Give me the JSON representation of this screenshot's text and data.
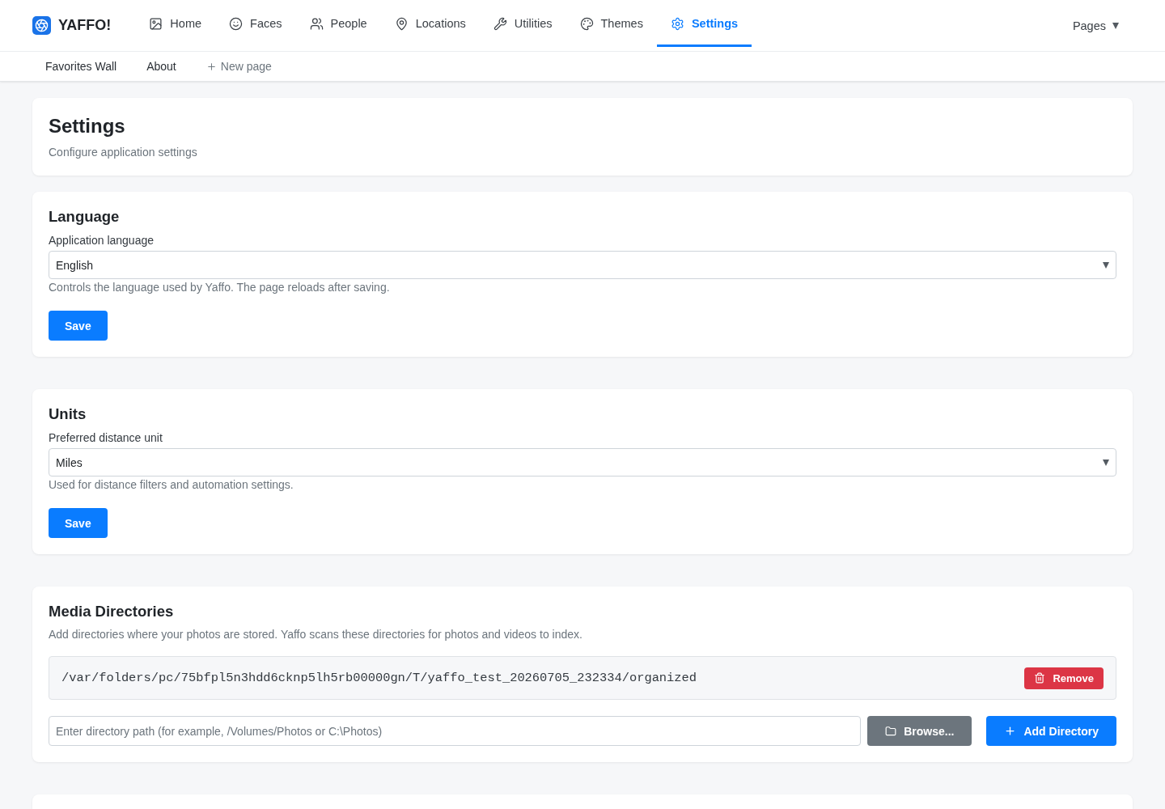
{
  "navbar": {
    "brand": "YAFFO!",
    "items": [
      {
        "label": "Home",
        "selected": false
      },
      {
        "label": "Faces",
        "selected": false
      },
      {
        "label": "People",
        "selected": false
      },
      {
        "label": "Locations",
        "selected": false
      },
      {
        "label": "Utilities",
        "selected": false
      },
      {
        "label": "Themes",
        "selected": false
      },
      {
        "label": "Settings",
        "selected": true
      }
    ],
    "pages_menu": "Pages"
  },
  "subnav": {
    "links": [
      "Favorites Wall",
      "About"
    ],
    "new_page": "New page"
  },
  "header": {
    "title": "Settings",
    "subtitle": "Configure application settings"
  },
  "sections": [
    {
      "kind": "select",
      "title": "Language",
      "field_label": "Application language",
      "value": "English",
      "help": "Controls the language used by Yaffo. The page reloads after saving.",
      "button": "Save"
    },
    {
      "kind": "select",
      "title": "Units",
      "field_label": "Preferred distance unit",
      "value": "Miles",
      "help": "Used for distance filters and automation settings.",
      "button": "Save"
    },
    {
      "kind": "directories",
      "title": "Media Directories",
      "description": "Add directories where your photos are stored. Yaffo scans these directories for photos and videos to index.",
      "directories": [
        {
          "path": "/var/folders/pc/75bfpl5n3hdd6cknp5lh5rb00000gn/T/yaffo_test_20260705_232334/organized",
          "remove": "Remove"
        }
      ],
      "input": {
        "placeholder": "Enter directory path (for example, /Volumes/Photos or C:\\Photos)"
      },
      "browse": "Browse...",
      "add": "Add Directory"
    }
  ]
}
